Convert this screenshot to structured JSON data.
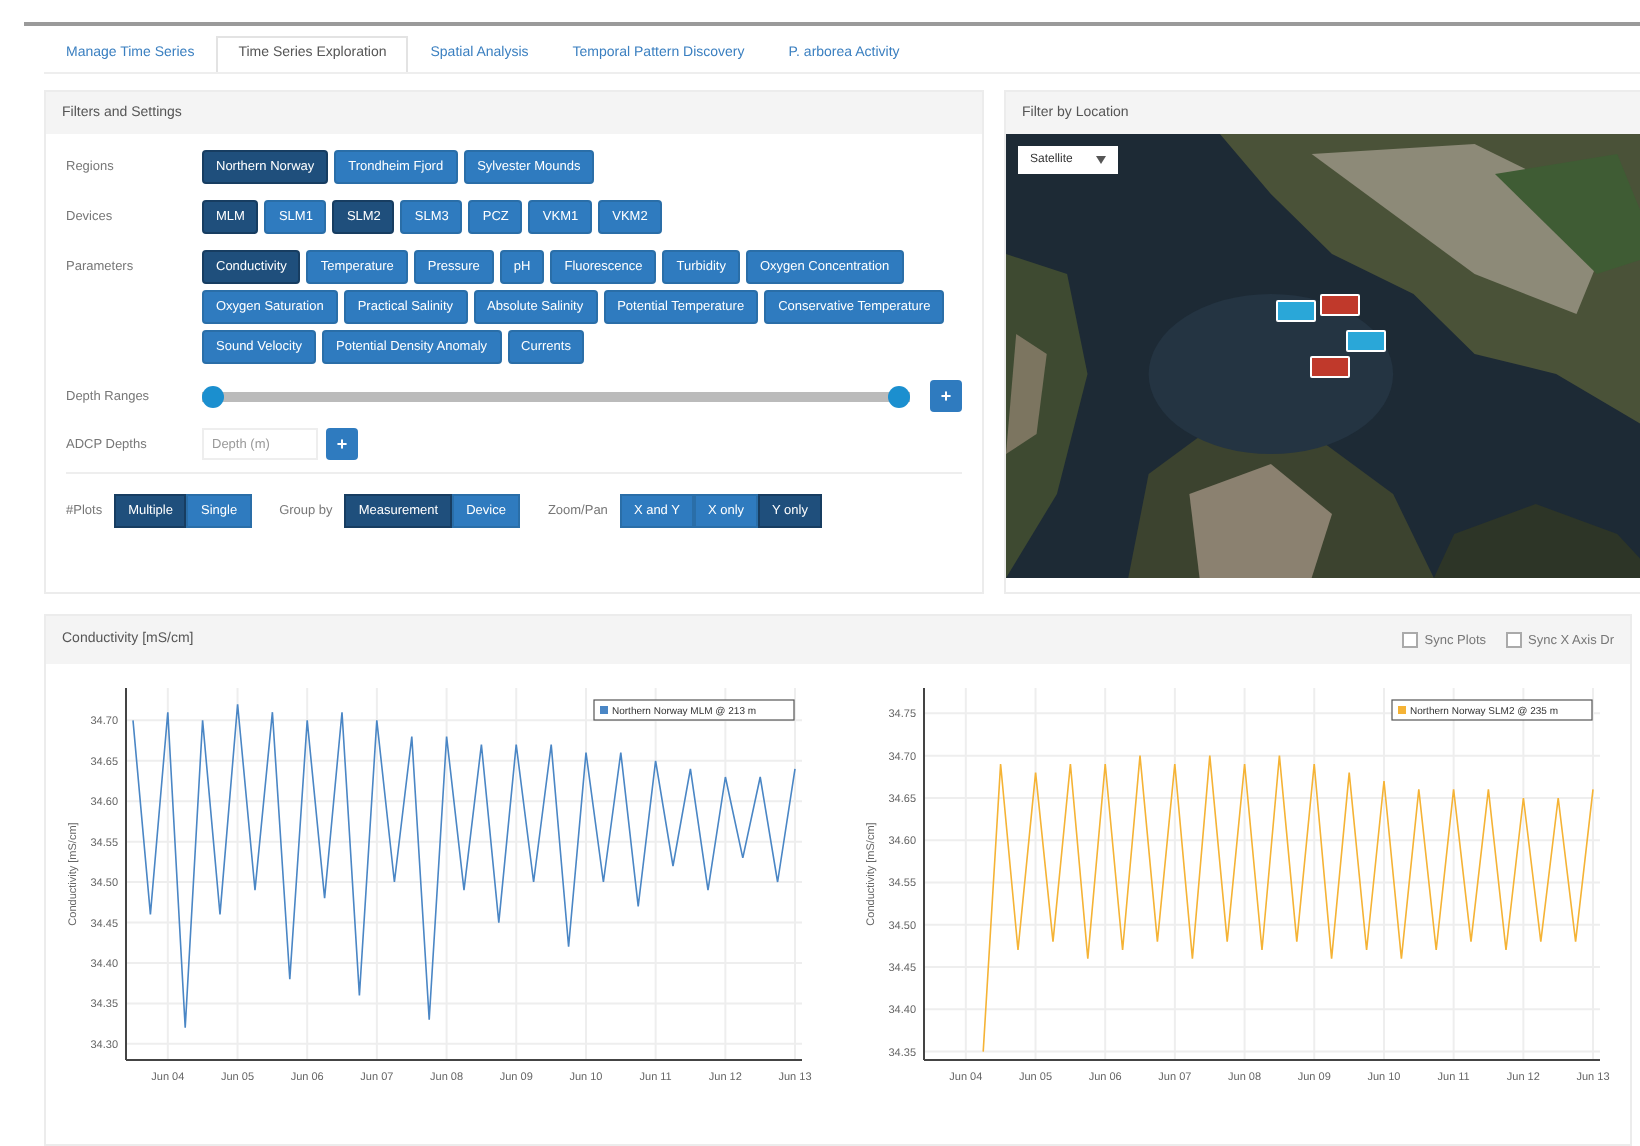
{
  "tabs": [
    {
      "label": "Manage Time Series",
      "selected": false
    },
    {
      "label": "Time Series Exploration",
      "selected": true
    },
    {
      "label": "Spatial Analysis",
      "selected": false
    },
    {
      "label": "Temporal Pattern Discovery",
      "selected": false
    },
    {
      "label": "P. arborea Activity",
      "selected": false
    }
  ],
  "filters": {
    "title": "Filters and Settings",
    "rows": [
      {
        "kind": "buttons",
        "label": "Regions",
        "options": [
          {
            "label": "Northern Norway",
            "selected": true
          },
          {
            "label": "Trondheim Fjord",
            "selected": false
          },
          {
            "label": "Sylvester Mounds",
            "selected": false
          }
        ]
      },
      {
        "kind": "buttons",
        "label": "Devices",
        "options": [
          {
            "label": "MLM",
            "selected": true
          },
          {
            "label": "SLM1",
            "selected": false
          },
          {
            "label": "SLM2",
            "selected": true
          },
          {
            "label": "SLM3",
            "selected": false
          },
          {
            "label": "PCZ",
            "selected": false
          },
          {
            "label": "VKM1",
            "selected": false
          },
          {
            "label": "VKM2",
            "selected": false
          }
        ]
      },
      {
        "kind": "buttons",
        "label": "Parameters",
        "options": [
          {
            "label": "Conductivity",
            "selected": true
          },
          {
            "label": "Temperature",
            "selected": false
          },
          {
            "label": "Pressure",
            "selected": false
          },
          {
            "label": "pH",
            "selected": false
          },
          {
            "label": "Fluorescence",
            "selected": false
          },
          {
            "label": "Turbidity",
            "selected": false
          },
          {
            "label": "Oxygen Concentration",
            "selected": false
          },
          {
            "label": "Oxygen Saturation",
            "selected": false
          },
          {
            "label": "Practical Salinity",
            "selected": false
          },
          {
            "label": "Absolute Salinity",
            "selected": false
          },
          {
            "label": "Potential Temperature",
            "selected": false
          },
          {
            "label": "Conservative Temperature",
            "selected": false
          },
          {
            "label": "Sound Velocity",
            "selected": false
          },
          {
            "label": "Potential Density Anomaly",
            "selected": false
          },
          {
            "label": "Currents",
            "selected": false
          }
        ]
      },
      {
        "kind": "range",
        "label": "Depth Ranges",
        "handles": [
          {
            "level": 0
          },
          {
            "level": 1
          }
        ],
        "button": "+"
      },
      {
        "kind": "input",
        "label": "ADCP Depths",
        "placeholder": "Depth (m)",
        "button": "+"
      },
      {
        "kind": "toggles",
        "groups": [
          {
            "label": "#Plots",
            "options": [
              {
                "label": "Multiple",
                "selected": true
              },
              {
                "label": "Single",
                "selected": false
              }
            ]
          },
          {
            "label": "Group by",
            "options": [
              {
                "label": "Measurement",
                "selected": true
              },
              {
                "label": "Device",
                "selected": false
              }
            ]
          },
          {
            "label": "Zoom/Pan",
            "options": [
              {
                "label": "X and Y",
                "selected": false
              },
              {
                "label": "X only",
                "selected": false
              },
              {
                "label": "Y only",
                "selected": true
              }
            ]
          }
        ]
      }
    ]
  },
  "map": {
    "title": "Filter by Location",
    "map_type": "Satellite",
    "markers": [
      {
        "color": "#2aa7d8"
      },
      {
        "color": "#c0392b"
      },
      {
        "color": "#2aa7d8"
      },
      {
        "color": "#c0392b"
      }
    ]
  },
  "charts_panel": {
    "title": "Conductivity [mS/cm]",
    "options": [
      {
        "label": "Sync Plots",
        "checked": false
      },
      {
        "label": "Sync X Axis Dr",
        "checked": false
      }
    ],
    "charts": [
      {
        "chart_data": {
          "type": "line",
          "grid": true,
          "ylabel": "Conductivity [mS/cm]",
          "ylim": [
            34.28,
            34.74
          ],
          "categories": [
            null,
            null,
            "Jun 04",
            null,
            null,
            null,
            "Jun 05",
            null,
            null,
            null,
            "Jun 06",
            null,
            null,
            null,
            "Jun 07",
            null,
            null,
            null,
            "Jun 08",
            null,
            null,
            null,
            "Jun 09",
            null,
            null,
            null,
            "Jun 10",
            null,
            null,
            null,
            "Jun 11",
            null,
            null,
            null,
            "Jun 12",
            null,
            null,
            null,
            "Jun 13"
          ],
          "yticks": [
            {
              "value": 34.3,
              "label": "34.30"
            },
            {
              "value": 34.35,
              "label": "34.35"
            },
            {
              "value": 34.4,
              "label": "34.40"
            },
            {
              "value": 34.45,
              "label": "34.45"
            },
            {
              "value": 34.5,
              "label": "34.50"
            },
            {
              "value": 34.55,
              "label": "34.55"
            },
            {
              "value": 34.6,
              "label": "34.60"
            },
            {
              "value": 34.65,
              "label": "34.65"
            },
            {
              "value": 34.7,
              "label": "34.70"
            }
          ],
          "series": [
            {
              "name": "Northern Norway MLM @ 213 m",
              "color": "#4a86c5",
              "values": [
                34.7,
                34.46,
                34.71,
                34.32,
                34.7,
                34.46,
                34.72,
                34.49,
                34.71,
                34.38,
                34.7,
                34.48,
                34.71,
                34.36,
                34.7,
                34.5,
                34.68,
                34.33,
                34.68,
                34.49,
                34.67,
                34.45,
                34.67,
                34.5,
                34.67,
                34.42,
                34.66,
                34.5,
                34.66,
                34.47,
                34.65,
                34.52,
                34.64,
                34.49,
                34.63,
                34.53,
                34.63,
                34.5,
                34.64
              ]
            }
          ]
        }
      },
      {
        "chart_data": {
          "type": "line",
          "grid": true,
          "ylabel": "Conductivity [mS/cm]",
          "ylim": [
            34.34,
            34.78
          ],
          "categories": [
            null,
            null,
            "Jun 04",
            null,
            null,
            null,
            "Jun 05",
            null,
            null,
            null,
            "Jun 06",
            null,
            null,
            null,
            "Jun 07",
            null,
            null,
            null,
            "Jun 08",
            null,
            null,
            null,
            "Jun 09",
            null,
            null,
            null,
            "Jun 10",
            null,
            null,
            null,
            "Jun 11",
            null,
            null,
            null,
            "Jun 12",
            null,
            null,
            null,
            "Jun 13"
          ],
          "yticks": [
            {
              "value": 34.35,
              "label": "34.35"
            },
            {
              "value": 34.4,
              "label": "34.40"
            },
            {
              "value": 34.45,
              "label": "34.45"
            },
            {
              "value": 34.5,
              "label": "34.50"
            },
            {
              "value": 34.55,
              "label": "34.55"
            },
            {
              "value": 34.6,
              "label": "34.60"
            },
            {
              "value": 34.65,
              "label": "34.65"
            },
            {
              "value": 34.7,
              "label": "34.70"
            },
            {
              "value": 34.75,
              "label": "34.75"
            }
          ],
          "series": [
            {
              "name": "Northern Norway SLM2 @ 235 m",
              "color": "#f5b335",
              "values": [
                null,
                null,
                null,
                34.35,
                34.69,
                34.47,
                34.68,
                34.48,
                34.69,
                34.46,
                34.69,
                34.47,
                34.7,
                34.48,
                34.69,
                34.46,
                34.7,
                34.48,
                34.69,
                34.47,
                34.7,
                34.48,
                34.69,
                34.46,
                34.68,
                34.47,
                34.67,
                34.46,
                34.66,
                34.47,
                34.66,
                34.48,
                34.66,
                34.47,
                34.65,
                34.48,
                34.65,
                34.48,
                34.66
              ]
            }
          ]
        }
      }
    ]
  }
}
